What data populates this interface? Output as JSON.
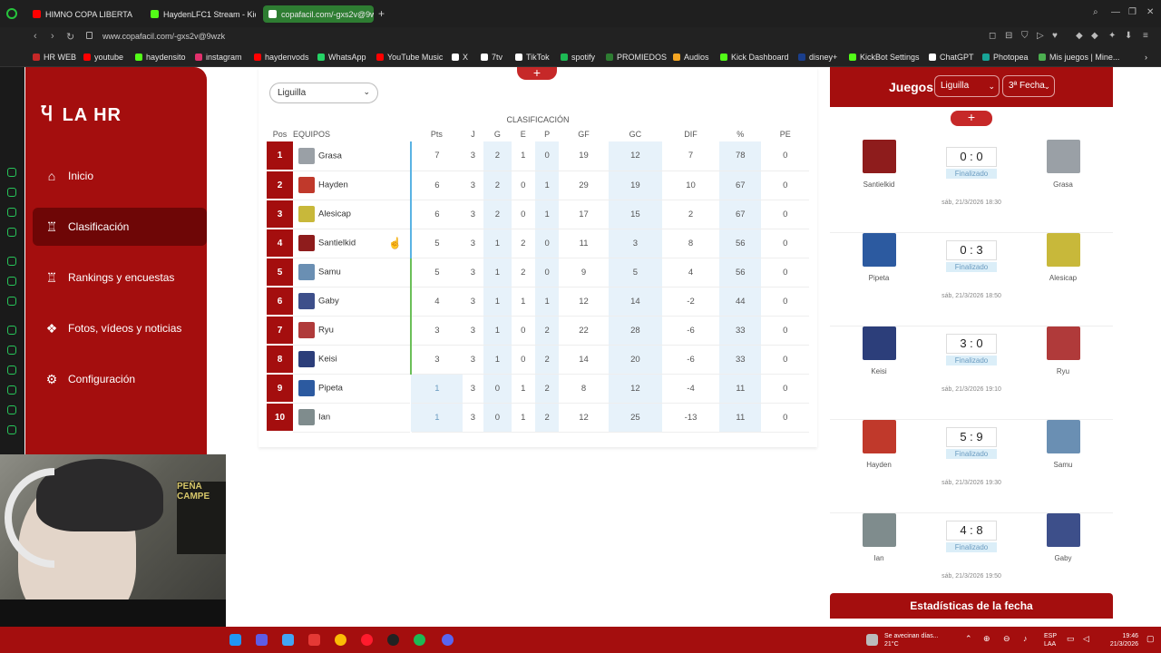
{
  "browser": {
    "tabs": [
      {
        "label": "HIMNO COPA LIBERTA",
        "color": "#ff0000"
      },
      {
        "label": "HaydenLFC1 Stream - Kick",
        "color": "#53fc18"
      },
      {
        "label": "copafacil.com/-gxs2v@9wzk",
        "color": "#ffffff"
      }
    ],
    "url": "www.copafacil.com/-gxs2v@9wzk",
    "bookmarks": [
      {
        "label": "HR WEB",
        "color": "#c62828"
      },
      {
        "label": "youtube",
        "color": "#ff0000"
      },
      {
        "label": "haydensito",
        "color": "#53fc18"
      },
      {
        "label": "instagram",
        "color": "#e1306c"
      },
      {
        "label": "haydenvods",
        "color": "#ff0000"
      },
      {
        "label": "WhatsApp",
        "color": "#25d366"
      },
      {
        "label": "YouTube Music",
        "color": "#ff0000"
      },
      {
        "label": "X",
        "color": "#ffffff"
      },
      {
        "label": "7tv",
        "color": "#ffffff"
      },
      {
        "label": "TikTok",
        "color": "#ffffff"
      },
      {
        "label": "spotify",
        "color": "#1db954"
      },
      {
        "label": "PROMIEDOS",
        "color": "#2e7d32"
      },
      {
        "label": "Audios",
        "color": "#f5a623"
      },
      {
        "label": "Kick Dashboard",
        "color": "#53fc18"
      },
      {
        "label": "disney+",
        "color": "#1a3e8c"
      },
      {
        "label": "KickBot Settings",
        "color": "#53fc18"
      },
      {
        "label": "ChatGPT",
        "color": "#ffffff"
      },
      {
        "label": "Photopea",
        "color": "#18a497"
      },
      {
        "label": "Mis juegos | Mine...",
        "color": "#4caf50"
      }
    ]
  },
  "site": {
    "logo": "LA HR",
    "nav": [
      {
        "label": "Inicio",
        "icon": "home-icon"
      },
      {
        "label": "Clasificación",
        "icon": "podium-icon"
      },
      {
        "label": "Rankings y encuestas",
        "icon": "podium-icon"
      },
      {
        "label": "Fotos, vídeos y noticias",
        "icon": "media-icon"
      },
      {
        "label": "Configuración",
        "icon": "gear-icon"
      }
    ]
  },
  "standings": {
    "filter": "Liguilla",
    "section_label": "CLASIFICACIÓN",
    "columns": [
      "Pos",
      "EQUIPOS",
      "Pts",
      "J",
      "G",
      "E",
      "P",
      "GF",
      "GC",
      "DIF",
      "%",
      "PE"
    ],
    "rows": [
      {
        "pos": "1",
        "team": "Grasa",
        "pts": "7",
        "j": "3",
        "g": "2",
        "e": "1",
        "p": "0",
        "gf": "19",
        "gc": "12",
        "dif": "7",
        "pct": "78",
        "pe": "0",
        "zone": "b",
        "av": "#9aa0a6"
      },
      {
        "pos": "2",
        "team": "Hayden",
        "pts": "6",
        "j": "3",
        "g": "2",
        "e": "0",
        "p": "1",
        "gf": "29",
        "gc": "19",
        "dif": "10",
        "pct": "67",
        "pe": "0",
        "zone": "b",
        "av": "#c0392b"
      },
      {
        "pos": "3",
        "team": "Alesicap",
        "pts": "6",
        "j": "3",
        "g": "2",
        "e": "0",
        "p": "1",
        "gf": "17",
        "gc": "15",
        "dif": "2",
        "pct": "67",
        "pe": "0",
        "zone": "b",
        "av": "#c8b83a"
      },
      {
        "pos": "4",
        "team": "Santielkid",
        "pts": "5",
        "j": "3",
        "g": "1",
        "e": "2",
        "p": "0",
        "gf": "11",
        "gc": "3",
        "dif": "8",
        "pct": "56",
        "pe": "0",
        "zone": "b",
        "av": "#8e1c1c"
      },
      {
        "pos": "5",
        "team": "Samu",
        "pts": "5",
        "j": "3",
        "g": "1",
        "e": "2",
        "p": "0",
        "gf": "9",
        "gc": "5",
        "dif": "4",
        "pct": "56",
        "pe": "0",
        "zone": "g",
        "av": "#6a8fb3"
      },
      {
        "pos": "6",
        "team": "Gaby",
        "pts": "4",
        "j": "3",
        "g": "1",
        "e": "1",
        "p": "1",
        "gf": "12",
        "gc": "14",
        "dif": "-2",
        "pct": "44",
        "pe": "0",
        "zone": "g",
        "av": "#3d4f8a"
      },
      {
        "pos": "7",
        "team": "Ryu",
        "pts": "3",
        "j": "3",
        "g": "1",
        "e": "0",
        "p": "2",
        "gf": "22",
        "gc": "28",
        "dif": "-6",
        "pct": "33",
        "pe": "0",
        "zone": "g",
        "av": "#b03a3a"
      },
      {
        "pos": "8",
        "team": "Keisi",
        "pts": "3",
        "j": "3",
        "g": "1",
        "e": "0",
        "p": "2",
        "gf": "14",
        "gc": "20",
        "dif": "-6",
        "pct": "33",
        "pe": "0",
        "zone": "g",
        "av": "#2c3e7a"
      },
      {
        "pos": "9",
        "team": "Pipeta",
        "pts": "1",
        "j": "3",
        "g": "0",
        "e": "1",
        "p": "2",
        "gf": "8",
        "gc": "12",
        "dif": "-4",
        "pct": "11",
        "pe": "0",
        "zone": "w",
        "av": "#2c5aa0"
      },
      {
        "pos": "10",
        "team": "Ian",
        "pts": "1",
        "j": "3",
        "g": "0",
        "e": "1",
        "p": "2",
        "gf": "12",
        "gc": "25",
        "dif": "-13",
        "pct": "11",
        "pe": "0",
        "zone": "w",
        "av": "#7f8c8d"
      }
    ]
  },
  "games": {
    "title": "Juegos",
    "phase": "Liguilla",
    "round": "3ª Fecha",
    "matches": [
      {
        "home": "Santielkid",
        "away": "Grasa",
        "score": "0 : 0",
        "status": "Finalizado",
        "date": "sáb, 21/3/2026 18:30",
        "home_color": "#8e1c1c",
        "away_color": "#9aa0a6"
      },
      {
        "home": "Pipeta",
        "away": "Alesicap",
        "score": "0 : 3",
        "status": "Finalizado",
        "date": "sáb, 21/3/2026 18:50",
        "home_color": "#2c5aa0",
        "away_color": "#c8b83a"
      },
      {
        "home": "Keisi",
        "away": "Ryu",
        "score": "3 : 0",
        "status": "Finalizado",
        "date": "sáb, 21/3/2026 19:10",
        "home_color": "#2c3e7a",
        "away_color": "#b03a3a"
      },
      {
        "home": "Hayden",
        "away": "Samu",
        "score": "5 : 9",
        "status": "Finalizado",
        "date": "sáb, 21/3/2026 19:30",
        "home_color": "#c0392b",
        "away_color": "#6a8fb3"
      },
      {
        "home": "Ian",
        "away": "Gaby",
        "score": "4 : 8",
        "status": "Finalizado",
        "date": "sáb, 21/3/2026 19:50",
        "home_color": "#7f8c8d",
        "away_color": "#3d4f8a"
      }
    ],
    "stats_button": "Estadísticas de la fecha"
  },
  "webcam": {
    "poster_text": "PEÑA CAMPE"
  },
  "taskbar": {
    "weather_line1": "Se avecinan días...",
    "weather_line2": "21°C",
    "lang_line1": "ESP",
    "lang_line2": "LAA",
    "time": "19:46",
    "date": "21/3/2026"
  },
  "colors": {
    "brand": "#a40e0e",
    "accent": "#c62828"
  }
}
